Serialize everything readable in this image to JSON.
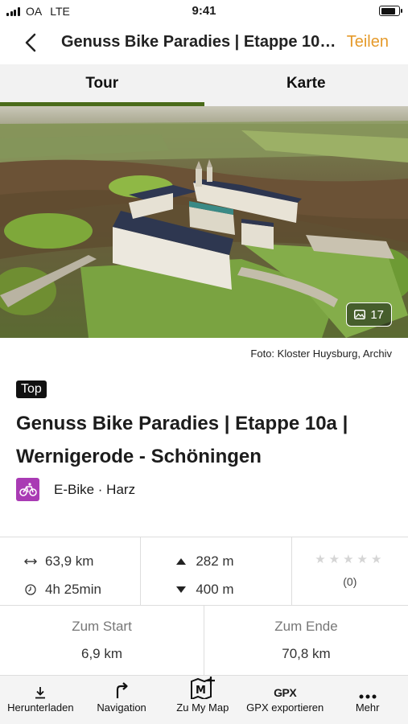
{
  "status_bar": {
    "carrier": "OA",
    "network": "LTE",
    "time": "9:41",
    "battery_level": 0.85
  },
  "header": {
    "back_icon": "chevron-left-icon",
    "title": "Genuss Bike Paradies | Etappe 10a | Wernigerode - Schöningen",
    "share_label": "Teilen",
    "accent_color": "#e59a2a"
  },
  "tabs": [
    {
      "label": "Tour",
      "active": true
    },
    {
      "label": "Karte",
      "active": false
    }
  ],
  "tab_indicator_color": "#4a6b1a",
  "hero": {
    "photo_count": "17",
    "credit": "Foto: Kloster Huysburg, Archiv"
  },
  "badge": "Top",
  "tour_title": "Genuss Bike Paradies | Etappe 10a | Wernigerode - Schöningen",
  "category": {
    "text": "E-Bike · Harz",
    "icon": "ebike-icon",
    "icon_color": "#a93bb4"
  },
  "stats": {
    "distance": "63,9 km",
    "duration": "4h 25min",
    "ascent": "282 m",
    "descent": "400 m",
    "rating_stars": 0,
    "rating_max": 5,
    "rating_count": "(0)"
  },
  "start_end": {
    "start_label": "Zum Start",
    "start_value": "6,9 km",
    "end_label": "Zum Ende",
    "end_value": "70,8 km"
  },
  "toolbar": [
    {
      "label": "Herunterladen",
      "icon": "download-icon"
    },
    {
      "label": "Navigation",
      "icon": "turn-right-arrow-icon"
    },
    {
      "label": "Zu My Map",
      "icon": "map-add-icon"
    },
    {
      "label": "GPX exportieren",
      "icon": "gpx-icon",
      "icon_text": "GPX"
    },
    {
      "label": "Mehr",
      "icon": "more-dots-icon"
    }
  ]
}
